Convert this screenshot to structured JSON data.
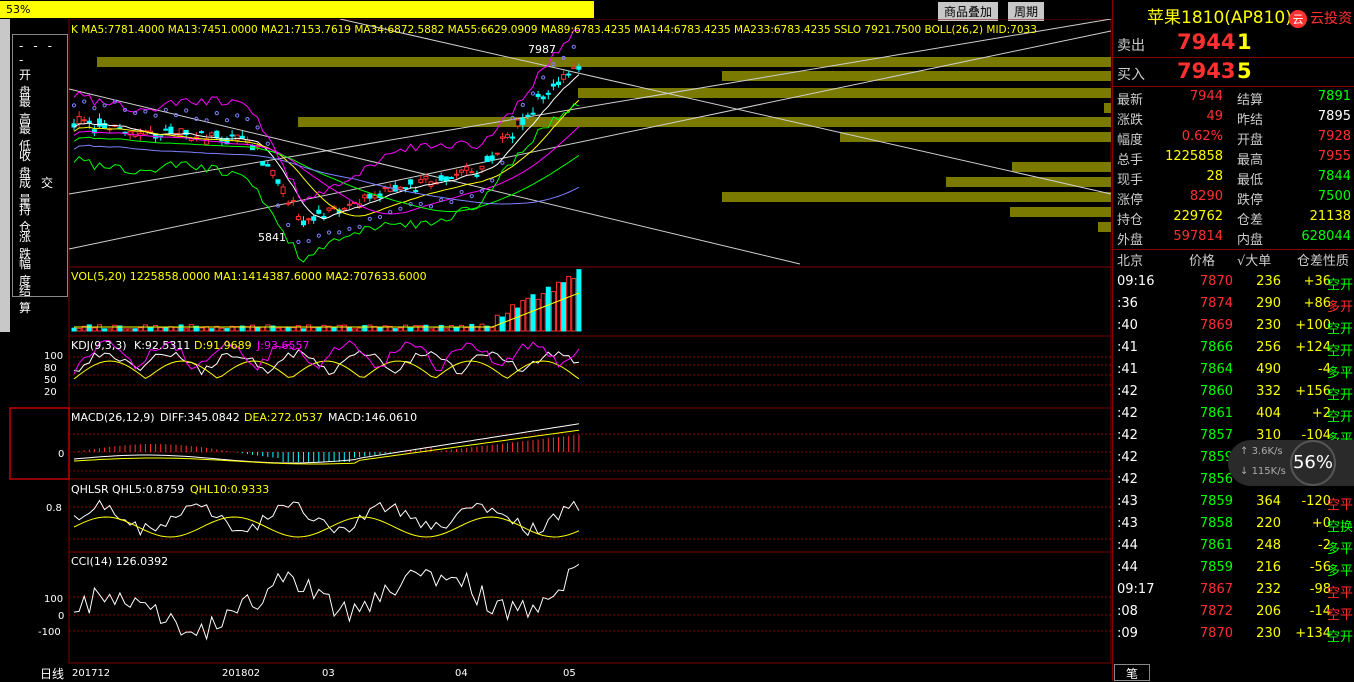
{
  "toolbar": {
    "progress_pct": "53%",
    "progress_value": 0.53,
    "menu_overlay": "商品叠加",
    "menu_period": "周期"
  },
  "leftpanel": {
    "rows": [
      "----",
      "开 盘",
      "最 高",
      "最 低",
      "收 盘",
      "成交量",
      "持 仓",
      "涨 跌",
      "幅 度",
      "结 算"
    ]
  },
  "main": {
    "indicator_text": "K  MA5:7781.4000 MA13:7451.0000 MA21:7153.7619 MA34:6872.5882 MA55:6629.0909 MA89:6783.4235 MA144:6783.4235 MA233:6783.4235  SSLO 7921.7500  BOLL(26,2) MID:7033",
    "high_label": "7987",
    "low_label": "5841"
  },
  "vol": {
    "text": "VOL(5,20) 1225858.0000 MA1:1414387.6000 MA2:707633.6000"
  },
  "kdj": {
    "title": "KDJ(9,3,3)",
    "k": "K:92.5311",
    "d": "D:91.9689",
    "j": "J:93.6557",
    "ticks": [
      "100",
      "80",
      "50",
      "20"
    ]
  },
  "macd": {
    "title": "MACD(26,12,9)",
    "diff": "DIFF:345.0842",
    "dea": "DEA:272.0537",
    "macd": "MACD:146.0610",
    "tick": "0"
  },
  "qhlsr": {
    "title": "QHLSR",
    "q5": "QHL5:0.8759",
    "q10": "QHL10:0.9333",
    "tick": "0.8"
  },
  "cci": {
    "text": "CCI(14) 126.0392",
    "ticks": [
      "100",
      "0",
      "-100"
    ]
  },
  "xaxis": {
    "period": "日线",
    "labels": [
      "201712",
      "201802",
      "03",
      "04",
      "05"
    ]
  },
  "colors": {
    "up": "#ff3030",
    "down": "#00ffff",
    "yellow": "#ffff00",
    "green": "#00ff00",
    "panel_border": "#800000"
  },
  "quote": {
    "title": "苹果1810(AP810)",
    "logo": "云投资",
    "sell_label": "卖出",
    "sell_price": "7944",
    "sell_vol": "1",
    "buy_label": "买入",
    "buy_price": "7943",
    "buy_vol": "5",
    "rows": [
      {
        "l1": "最新",
        "v1": "7944",
        "c1": "#ff3030",
        "l2": "结算",
        "v2": "7891",
        "c2": "#00ff00"
      },
      {
        "l1": "涨跌",
        "v1": "49",
        "c1": "#ff3030",
        "l2": "昨结",
        "v2": "7895",
        "c2": "#ffffff"
      },
      {
        "l1": "幅度",
        "v1": "0.62%",
        "c1": "#ff3030",
        "l2": "开盘",
        "v2": "7928",
        "c2": "#ff3030"
      },
      {
        "l1": "总手",
        "v1": "1225858",
        "c1": "#ffff00",
        "l2": "最高",
        "v2": "7955",
        "c2": "#ff3030"
      },
      {
        "l1": "现手",
        "v1": "28",
        "c1": "#ffff00",
        "l2": "最低",
        "v2": "7844",
        "c2": "#00ff00"
      },
      {
        "l1": "涨停",
        "v1": "8290",
        "c1": "#ff3030",
        "l2": "跌停",
        "v2": "7500",
        "c2": "#00ff00"
      },
      {
        "l1": "持仓",
        "v1": "229762",
        "c1": "#ffff00",
        "l2": "仓差",
        "v2": "21138",
        "c2": "#ffff00"
      },
      {
        "l1": "外盘",
        "v1": "597814",
        "c1": "#ff3030",
        "l2": "内盘",
        "v2": "628044",
        "c2": "#00ff00"
      }
    ],
    "header": {
      "c1": "北京",
      "c2": "价格",
      "c3": "√大单",
      "c4": "仓差",
      "c5": "性质"
    },
    "ticks": [
      {
        "t": "09:16",
        "p": "7870",
        "v": "236",
        "oi": "+36",
        "n": "空开",
        "nc": "#00ff00"
      },
      {
        "t": ":36",
        "p": "7874",
        "v": "290",
        "oi": "+86",
        "n": "多开",
        "nc": "#ff3030"
      },
      {
        "t": ":40",
        "p": "7869",
        "v": "230",
        "oi": "+100",
        "n": "空开",
        "nc": "#00ff00"
      },
      {
        "t": ":41",
        "p": "7866",
        "v": "256",
        "oi": "+124",
        "n": "空开",
        "nc": "#00ff00"
      },
      {
        "t": ":41",
        "p": "7864",
        "v": "490",
        "oi": "-4",
        "n": "多平",
        "nc": "#00ff00"
      },
      {
        "t": ":42",
        "p": "7860",
        "v": "332",
        "oi": "+156",
        "n": "空开",
        "nc": "#00ff00"
      },
      {
        "t": ":42",
        "p": "7861",
        "v": "404",
        "oi": "+2",
        "n": "空开",
        "nc": "#00ff00"
      },
      {
        "t": ":42",
        "p": "7857",
        "v": "310",
        "oi": "-104",
        "n": "多平",
        "nc": "#00ff00"
      },
      {
        "t": ":42",
        "p": "7859",
        "v": "",
        "oi": "",
        "n": "",
        "nc": "#00ff00"
      },
      {
        "t": ":42",
        "p": "7856",
        "v": "",
        "oi": "",
        "n": "",
        "nc": "#00ff00"
      },
      {
        "t": ":43",
        "p": "7859",
        "v": "364",
        "oi": "-120",
        "n": "空平",
        "nc": "#ff3030"
      },
      {
        "t": ":43",
        "p": "7858",
        "v": "220",
        "oi": "+0",
        "n": "空换",
        "nc": "#00ff00"
      },
      {
        "t": ":44",
        "p": "7861",
        "v": "248",
        "oi": "-2",
        "n": "多平",
        "nc": "#00ff00"
      },
      {
        "t": ":44",
        "p": "7859",
        "v": "216",
        "oi": "-56",
        "n": "多平",
        "nc": "#00ff00"
      },
      {
        "t": "09:17",
        "p": "7867",
        "v": "232",
        "oi": "-98",
        "n": "空平",
        "nc": "#ff3030"
      },
      {
        "t": ":08",
        "p": "7872",
        "v": "206",
        "oi": "-14",
        "n": "空平",
        "nc": "#ff3030"
      },
      {
        "t": ":09",
        "p": "7870",
        "v": "230",
        "oi": "+134",
        "n": "空开",
        "nc": "#00ff00"
      }
    ],
    "tab_label": "笔"
  },
  "network": {
    "up": "3.6K/s",
    "down": "115K/s",
    "pct": "56%"
  }
}
